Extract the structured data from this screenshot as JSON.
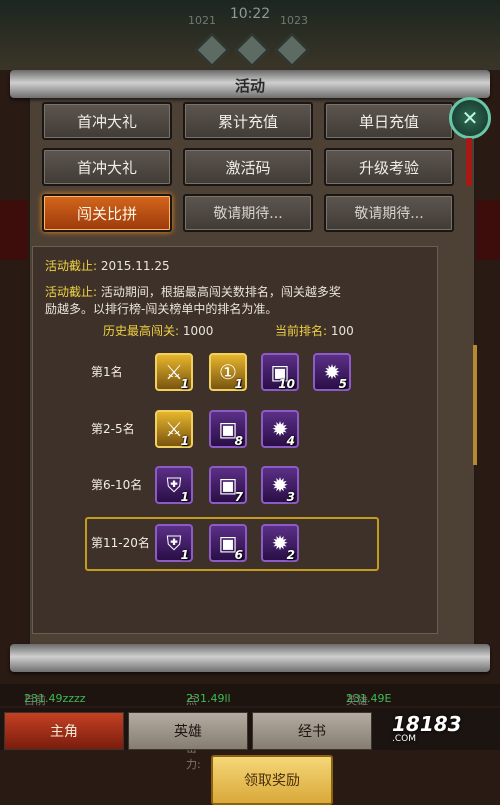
{
  "header": {
    "time": "10:22",
    "left_small": "1021",
    "right_small": "1023"
  },
  "panel": {
    "title": "活动"
  },
  "tabs": [
    {
      "label": "首冲大礼"
    },
    {
      "label": "累计充值"
    },
    {
      "label": "单日充值"
    },
    {
      "label": "首冲大礼"
    },
    {
      "label": "激活码"
    },
    {
      "label": "升级考验"
    },
    {
      "label": "闯关比拼"
    },
    {
      "label": "敬请期待..."
    },
    {
      "label": "敬请期待..."
    }
  ],
  "info": {
    "deadline_label": "活动截止:",
    "deadline_value": "2015.11.25",
    "desc_label": "活动截止:",
    "desc_line1": "活动期间，根据最高闯关数排名，闯关越多奖",
    "desc_line2": "励越多。以排行榜-闯关榜单中的排名为准。",
    "best_label": "历史最高闯关:",
    "best_value": "1000",
    "rank_label": "当前排名:",
    "rank_value": "100"
  },
  "rewards": [
    {
      "rank": "第1名",
      "items": [
        {
          "icon": "sword-icon",
          "count": "1"
        },
        {
          "icon": "gold-token-icon",
          "count": "1"
        },
        {
          "icon": "chest-icon",
          "count": "10"
        },
        {
          "icon": "gem-icon",
          "count": "5"
        }
      ]
    },
    {
      "rank": "第2-5名",
      "items": [
        {
          "icon": "sword-icon",
          "count": "1"
        },
        {
          "icon": "chest-icon",
          "count": "8"
        },
        {
          "icon": "gem-icon",
          "count": "4"
        }
      ]
    },
    {
      "rank": "第6-10名",
      "items": [
        {
          "icon": "armor-icon",
          "count": "1"
        },
        {
          "icon": "chest-icon",
          "count": "7"
        },
        {
          "icon": "gem-icon",
          "count": "3"
        }
      ]
    },
    {
      "rank": "第11-20名",
      "items": [
        {
          "icon": "armor-icon",
          "count": "1"
        },
        {
          "icon": "chest-icon",
          "count": "6"
        },
        {
          "icon": "gem-icon",
          "count": "2"
        }
      ]
    }
  ],
  "claim_button": "领取奖励",
  "stats": {
    "dps_label": "目前DPS:",
    "dps_value": "231.49zzzz",
    "click_label": "点击攻击力:",
    "click_value": "231.49ll",
    "hero_label": "英雄DPS:",
    "hero_value": "231.49E"
  },
  "nav": [
    {
      "label": "主角"
    },
    {
      "label": "英雄"
    },
    {
      "label": "经书"
    }
  ],
  "watermark": {
    "brand": "18183",
    "site": ".COM"
  },
  "colors": {
    "accent": "#d4661d",
    "label_yellow": "#efd243",
    "highlight": "#c49a1f"
  }
}
